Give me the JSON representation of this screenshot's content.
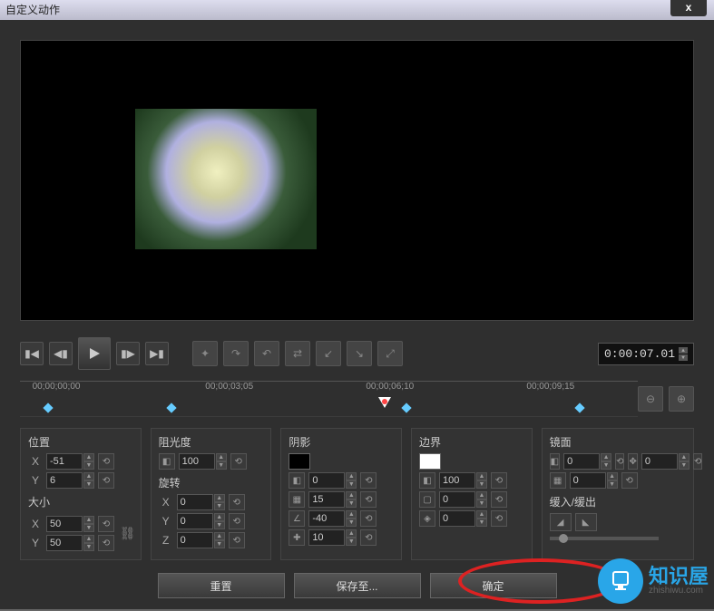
{
  "title": "自定义动作",
  "close_label": "x",
  "timecode": "0:00:07.01",
  "timeline": {
    "labels": [
      "00;00;00;00",
      "00;00;03;05",
      "00;00;06;10",
      "00;00;09;15"
    ],
    "keyframe_positions_pct": [
      4,
      24,
      62,
      90
    ],
    "playhead_pct": 58
  },
  "panels": {
    "position": {
      "title": "位置",
      "x_label": "X",
      "x_value": "-51",
      "y_label": "Y",
      "y_value": "6"
    },
    "size": {
      "title": "大小",
      "x_label": "X",
      "x_value": "50",
      "y_label": "Y",
      "y_value": "50"
    },
    "opacity": {
      "title": "阻光度",
      "value": "100"
    },
    "rotation": {
      "title": "旋转",
      "x_label": "X",
      "x_value": "0",
      "y_label": "Y",
      "y_value": "0",
      "z_label": "Z",
      "z_value": "0"
    },
    "shadow": {
      "title": "阴影",
      "swatch_color": "#000000",
      "v1": "0",
      "v2": "15",
      "v3": "-40",
      "v4": "10"
    },
    "border": {
      "title": "边界",
      "swatch_color": "#ffffff",
      "v1": "100",
      "v2": "0",
      "v3": "0"
    },
    "mirror": {
      "title": "镜面",
      "v1": "0",
      "v2": "0",
      "v3": "0"
    },
    "ease": {
      "title": "缓入/缓出"
    }
  },
  "footer": {
    "reset": "重置",
    "save_to": "保存至...",
    "ok": "确定"
  },
  "watermark": {
    "brand": "知识屋",
    "domain": "zhishiwu.com"
  }
}
